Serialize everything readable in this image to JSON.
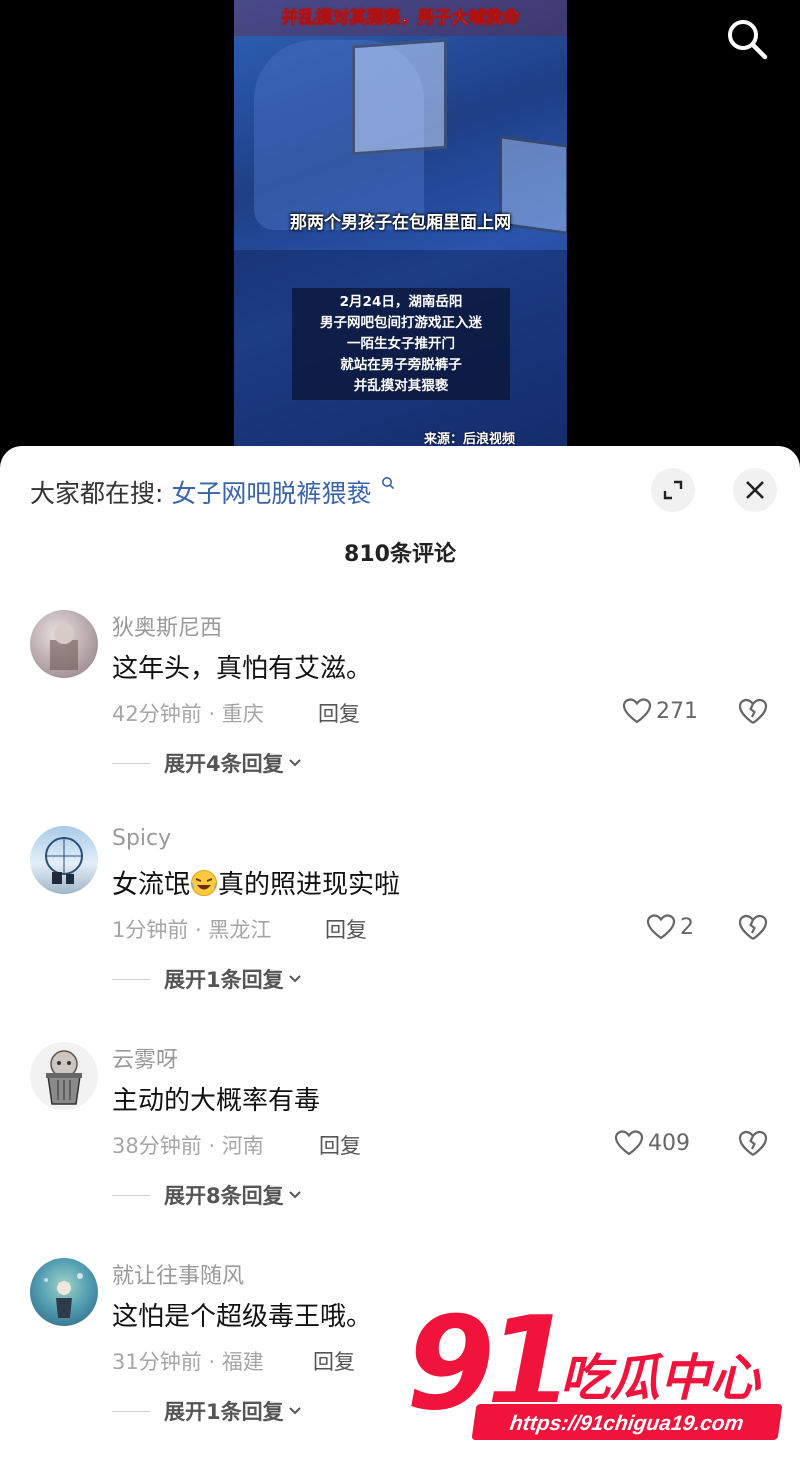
{
  "video": {
    "top_caption": "并乱摸对其猥亵，男子大喊救命",
    "mid_caption": "那两个男孩子在包厢里面上网",
    "box_lines": [
      "2月24日，湖南岳阳",
      "男子网吧包间打游戏正入迷",
      "一陌生女子推开门",
      "就站在男子旁脱裤子",
      "并乱摸对其猥亵"
    ],
    "source": "来源：后浪视频"
  },
  "sheet": {
    "suggest_prefix": "大家都在搜:",
    "suggest_term": "女子网吧脱裤猥亵",
    "comment_count": "810条评论"
  },
  "comments": [
    {
      "username": "狄奥斯尼西",
      "text": "这年头，真怕有艾滋。",
      "meta": "42分钟前 · 重庆",
      "reply": "回复",
      "likes": "271",
      "expand": "展开4条回复"
    },
    {
      "username": "Spicy",
      "text_before": "女流氓",
      "text_after": "真的照进现实啦",
      "meta": "1分钟前 · 黑龙江",
      "reply": "回复",
      "likes": "2",
      "expand": "展开1条回复"
    },
    {
      "username": "云雾呀",
      "text": "主动的大概率有毒",
      "meta": "38分钟前 · 河南",
      "reply": "回复",
      "likes": "409",
      "expand": "展开8条回复"
    },
    {
      "username": "就让往事随风",
      "text": "这怕是个超级毒王哦。",
      "meta": "31分钟前 · 福建",
      "reply": "回复",
      "expand": "展开1条回复"
    }
  ],
  "watermark": {
    "number": "91",
    "name": "吃瓜中心",
    "url": "https://91chigua19.com"
  }
}
